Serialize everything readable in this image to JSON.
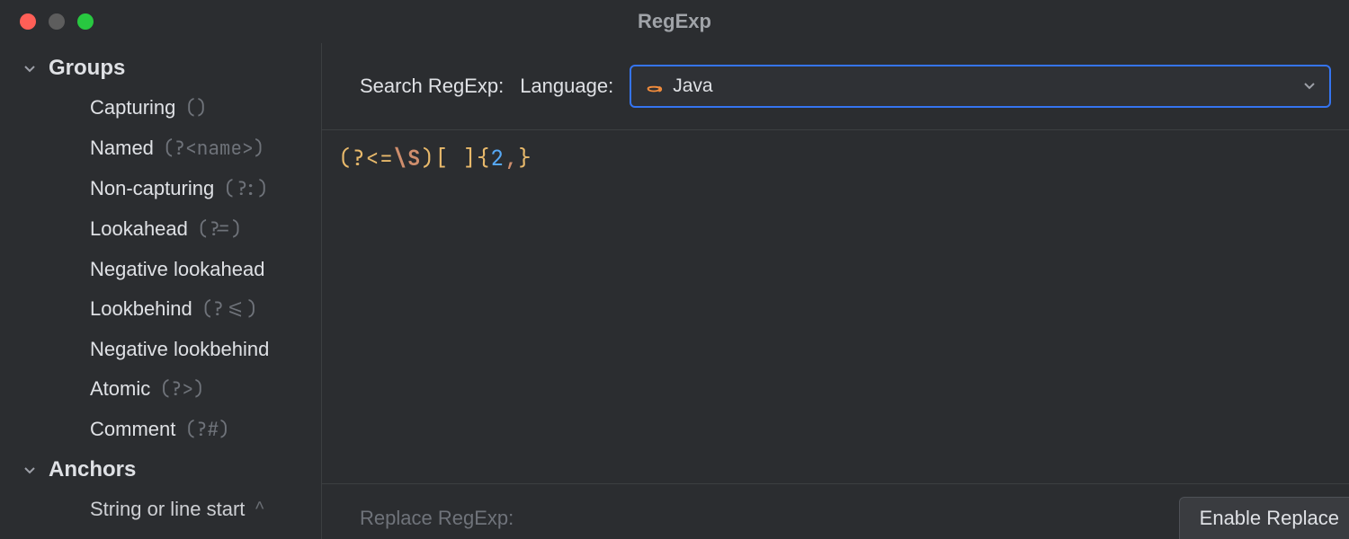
{
  "window": {
    "title": "RegExp"
  },
  "sidebar": {
    "sections": [
      {
        "title": "Groups",
        "items": [
          {
            "label": "Capturing",
            "syntax": "()"
          },
          {
            "label": "Named",
            "syntax": "(?<name>)"
          },
          {
            "label": "Non-capturing",
            "syntax": "(?:)"
          },
          {
            "label": "Lookahead",
            "syntax": "(?=)"
          },
          {
            "label": "Negative lookahead",
            "syntax": ""
          },
          {
            "label": "Lookbehind",
            "syntax": "(?<=)"
          },
          {
            "label": "Negative lookbehind",
            "syntax": ""
          },
          {
            "label": "Atomic",
            "syntax": "(?>)"
          },
          {
            "label": "Comment",
            "syntax": "(?#)"
          }
        ]
      },
      {
        "title": "Anchors",
        "items": [
          {
            "label": "String or line start",
            "syntax": "^"
          }
        ]
      }
    ]
  },
  "toolbar": {
    "search_label": "Search RegExp:",
    "language_label": "Language:",
    "language_value": "Java"
  },
  "editor": {
    "regex_tokens": [
      {
        "t": "(",
        "c": "tok-punc"
      },
      {
        "t": "?<=",
        "c": "tok-punc2"
      },
      {
        "t": "\\S",
        "c": "tok-esc"
      },
      {
        "t": ")",
        "c": "tok-punc"
      },
      {
        "t": "[",
        "c": "tok-set"
      },
      {
        "t": " ",
        "c": ""
      },
      {
        "t": "]",
        "c": "tok-set"
      },
      {
        "t": "{",
        "c": "tok-punc"
      },
      {
        "t": "2",
        "c": "tok-num"
      },
      {
        "t": ",",
        "c": "tok-comma"
      },
      {
        "t": "}",
        "c": "tok-punc"
      }
    ],
    "regex_plain": "(?<=\\S)[ ]{2,}"
  },
  "bottom": {
    "replace_label": "Replace RegExp:",
    "enable_replace_label": "Enable Replace"
  }
}
